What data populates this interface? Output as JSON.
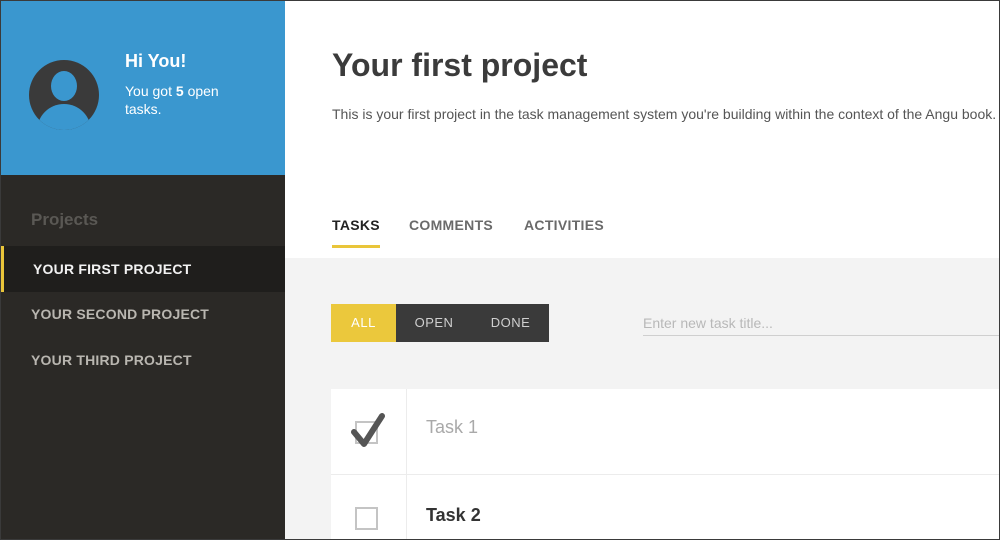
{
  "user": {
    "greeting": "Hi You!",
    "open_tasks_prefix": "You got",
    "open_tasks_count": "5",
    "open_tasks_suffix": "open tasks."
  },
  "sidebar": {
    "heading": "Projects",
    "items": [
      {
        "label": "YOUR FIRST PROJECT",
        "active": true
      },
      {
        "label": "YOUR SECOND PROJECT",
        "active": false
      },
      {
        "label": "YOUR THIRD PROJECT",
        "active": false
      }
    ]
  },
  "project": {
    "title": "Your first project",
    "description": "This is your first project in the task management system you're building within the context of the Angu book."
  },
  "tabs": [
    {
      "label": "TASKS",
      "active": true
    },
    {
      "label": "COMMENTS",
      "active": false
    },
    {
      "label": "ACTIVITIES",
      "active": false
    }
  ],
  "filters": {
    "all": "ALL",
    "open": "OPEN",
    "done": "DONE"
  },
  "new_task": {
    "placeholder": "Enter new task title..."
  },
  "tasks": [
    {
      "title": "Task 1",
      "done": true
    },
    {
      "title": "Task 2",
      "done": false
    }
  ],
  "colors": {
    "sidebar_bg": "#2b2926",
    "user_area_bg": "#3a97cf",
    "accent": "#e9c53a"
  }
}
